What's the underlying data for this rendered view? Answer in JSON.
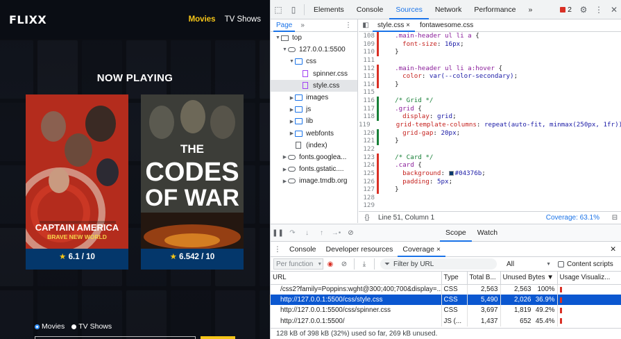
{
  "site": {
    "logo": "FLIXX",
    "nav": [
      "Movies",
      "TV Shows"
    ],
    "section_title": "NOW PLAYING",
    "cards": [
      {
        "poster_title": "CAPTAIN AMERICA",
        "poster_subtitle": "BRAVE NEW WORLD",
        "rating": "6.1 / 10"
      },
      {
        "poster_title_line1": "THE",
        "poster_title_line2": "CODES",
        "poster_title_line3": "OF WAR",
        "rating": "6.542 / 10"
      }
    ],
    "radio": [
      "Movies",
      "TV Shows"
    ],
    "accent_color": "#f5c518",
    "card_color": "#04376b"
  },
  "devtools": {
    "tabs": [
      "Elements",
      "Console",
      "Sources",
      "Network",
      "Performance"
    ],
    "active_tab": "Sources",
    "more_tabs": "»",
    "error_count": "2",
    "navigator": {
      "tab": "Page",
      "more": "»",
      "tree": [
        {
          "label": "top",
          "indent": 0,
          "arrow": "▼",
          "icon": "frame"
        },
        {
          "label": "127.0.0.1:5500",
          "indent": 1,
          "arrow": "▼",
          "icon": "cloud"
        },
        {
          "label": "css",
          "indent": 2,
          "arrow": "▼",
          "icon": "folder"
        },
        {
          "label": "spinner.css",
          "indent": 3,
          "arrow": "",
          "icon": "css"
        },
        {
          "label": "style.css",
          "indent": 3,
          "arrow": "",
          "icon": "css",
          "selected": true
        },
        {
          "label": "images",
          "indent": 2,
          "arrow": "▶",
          "icon": "folder"
        },
        {
          "label": "js",
          "indent": 2,
          "arrow": "▶",
          "icon": "folder"
        },
        {
          "label": "lib",
          "indent": 2,
          "arrow": "▶",
          "icon": "folder"
        },
        {
          "label": "webfonts",
          "indent": 2,
          "arrow": "▶",
          "icon": "folder"
        },
        {
          "label": "(index)",
          "indent": 2,
          "arrow": "",
          "icon": "file"
        },
        {
          "label": "fonts.googlea...",
          "indent": 1,
          "arrow": "▶",
          "icon": "cloud"
        },
        {
          "label": "fonts.gstatic....",
          "indent": 1,
          "arrow": "▶",
          "icon": "cloud"
        },
        {
          "label": "image.tmdb.org",
          "indent": 1,
          "arrow": "▶",
          "icon": "cloud"
        }
      ]
    },
    "editor_tabs": [
      {
        "label": "style.css",
        "close": "×",
        "active": true
      },
      {
        "label": "fontawesome.css",
        "close": "",
        "active": false
      }
    ],
    "code": [
      {
        "n": "108",
        "cov": "u",
        "html": "  <span class=\"sel-c\">.main-header ul li a</span> {"
      },
      {
        "n": "109",
        "cov": "u",
        "html": "    <span class=\"prop\">font-size</span>: <span class=\"val\">16px</span>;"
      },
      {
        "n": "110",
        "cov": "u",
        "html": "  }"
      },
      {
        "n": "111",
        "cov": "",
        "html": ""
      },
      {
        "n": "112",
        "cov": "u",
        "html": "  <span class=\"sel-c\">.main-header ul li a:hover</span> {"
      },
      {
        "n": "113",
        "cov": "u",
        "html": "    <span class=\"prop\">color</span>: <span class=\"val\">var(--color-secondary)</span>;"
      },
      {
        "n": "114",
        "cov": "u",
        "html": "  }"
      },
      {
        "n": "115",
        "cov": "",
        "html": ""
      },
      {
        "n": "116",
        "cov": "c",
        "html": "  <span class=\"cmt\">/* Grid */</span>"
      },
      {
        "n": "117",
        "cov": "c",
        "html": "  <span class=\"sel-c\">.grid</span> {"
      },
      {
        "n": "118",
        "cov": "c",
        "html": "    <span class=\"prop\">display</span>: <span class=\"val\">grid</span>;"
      },
      {
        "n": "119",
        "cov": "c",
        "html": "    <span class=\"prop\">grid-template-columns</span>: <span class=\"val\">repeat(auto-fit, minmax(250px, 1fr))</span>;"
      },
      {
        "n": "120",
        "cov": "c",
        "html": "    <span class=\"prop\">grid-gap</span>: <span class=\"val\">20px</span>;"
      },
      {
        "n": "121",
        "cov": "c",
        "html": "  }"
      },
      {
        "n": "122",
        "cov": "",
        "html": ""
      },
      {
        "n": "123",
        "cov": "u",
        "html": "  <span class=\"cmt\">/* Card */</span>"
      },
      {
        "n": "124",
        "cov": "u",
        "html": "  <span class=\"sel-c\">.card</span> {"
      },
      {
        "n": "125",
        "cov": "u",
        "html": "    <span class=\"prop\">background</span>: <span class=\"sw\"></span><span class=\"val\">#04376b</span>;"
      },
      {
        "n": "126",
        "cov": "u",
        "html": "    <span class=\"prop\">padding</span>: <span class=\"val\">5px</span>;"
      },
      {
        "n": "127",
        "cov": "u",
        "html": "  }"
      },
      {
        "n": "128",
        "cov": "",
        "html": ""
      },
      {
        "n": "129",
        "cov": "",
        "html": ""
      }
    ],
    "status": {
      "position": "Line 51, Column 1",
      "coverage": "Coverage: 63.1%"
    },
    "debug_tabs": [
      "Scope",
      "Watch"
    ],
    "drawer_tabs": [
      "Console",
      "Developer resources",
      "Coverage"
    ],
    "drawer_active": "Coverage",
    "coverage_toolbar": {
      "per_function": "Per function",
      "filter_placeholder": "Filter by URL",
      "all": "All",
      "content_scripts": "Content scripts"
    },
    "table": {
      "headers": [
        "URL",
        "Type",
        "Total B...",
        "Unused Bytes ▼",
        "Usage Visualiz..."
      ],
      "rows": [
        {
          "url": "/css2?family=Poppins:wght@300;400;700&display=...",
          "type": "CSS",
          "total": "2,563",
          "unused": "2,563",
          "pct": "100%",
          "selected": false
        },
        {
          "url": "http://127.0.0.1:5500/css/style.css",
          "type": "CSS",
          "total": "5,490",
          "unused": "2,026",
          "pct": "36.9%",
          "selected": true
        },
        {
          "url": "http://127.0.0.1:5500/css/spinner.css",
          "type": "CSS",
          "total": "3,697",
          "unused": "1,819",
          "pct": "49.2%",
          "selected": false
        },
        {
          "url": "http://127.0.0.1:5500/",
          "type": "JS (...",
          "total": "1,437",
          "unused": "652",
          "pct": "45.4%",
          "selected": false
        }
      ]
    },
    "footer": "128 kB of 398 kB (32%) used so far, 269 kB unused."
  }
}
